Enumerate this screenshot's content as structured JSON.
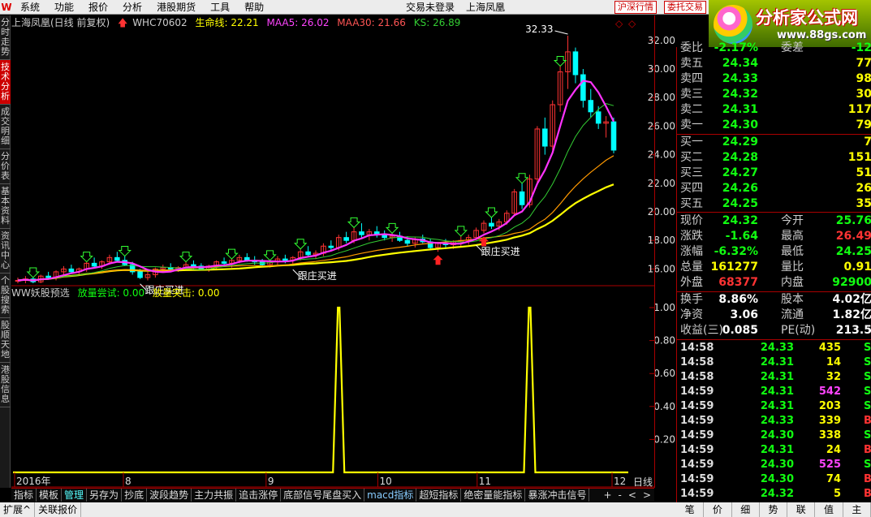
{
  "menu": {
    "logo": "W",
    "items": [
      "系统",
      "功能",
      "报价",
      "分析",
      "港股期货",
      "工具",
      "帮助"
    ],
    "login_status": "交易未登录",
    "stock_name": "上海凤凰",
    "btn_shhk": "沪深行情",
    "btn_ask": "委托交易"
  },
  "banner": {
    "title": "分析家公式网",
    "url": "www.88gs.com"
  },
  "left_tabs": [
    "分时走势",
    "技术分析",
    "成交明细",
    "分价表",
    "基本资料",
    "资讯中心",
    "个股搜索",
    "股顺天地",
    "港股信息"
  ],
  "left_tabs_active": 1,
  "chart": {
    "header": {
      "title": "上海凤凰(日线 前复权)",
      "code": "WHC70602",
      "lifeline_label": "生命线: 22.21",
      "maa5_label": "MAA5: 26.02",
      "maa30_label": "MAA30: 21.66",
      "ks_label": "KS: 26.89"
    },
    "high_label": "32.33",
    "buy_label_1": "跟庄买进",
    "buy_label_2": "跟庄买进",
    "buy_label_3": "跟庄买进",
    "price_ticks": [
      "32.00",
      "30.00",
      "28.00",
      "26.00",
      "24.00",
      "22.00",
      "20.00",
      "18.00",
      "16.00"
    ],
    "date_labels": [
      "2016年",
      "8",
      "9",
      "10",
      "11",
      "12"
    ],
    "indicator": {
      "header": "WW妖股预选",
      "label_a": "放量尝试: 0.00",
      "label_b": "放量突击: 0.00",
      "ticks": [
        "1.00",
        "0.80",
        "0.60",
        "0.40",
        "0.20"
      ]
    },
    "period": "日线"
  },
  "chart_data": {
    "type": "candlestick",
    "title": "上海凤凰(日线 前复权)",
    "ylim": [
      15.0,
      32.5
    ],
    "candles": [
      [
        15.2,
        15.4,
        15.0,
        15.2
      ],
      [
        15.2,
        15.5,
        15.0,
        15.3
      ],
      [
        15.3,
        15.4,
        15.0,
        15.1
      ],
      [
        15.1,
        15.6,
        15.0,
        15.5
      ],
      [
        15.5,
        15.8,
        15.3,
        15.4
      ],
      [
        15.4,
        15.9,
        15.2,
        15.8
      ],
      [
        15.8,
        16.2,
        15.6,
        16.0
      ],
      [
        16.0,
        16.3,
        15.7,
        15.8
      ],
      [
        15.8,
        16.1,
        15.6,
        16.0
      ],
      [
        16.0,
        16.5,
        15.8,
        16.4
      ],
      [
        16.4,
        16.8,
        16.1,
        16.2
      ],
      [
        16.2,
        16.6,
        16.0,
        16.5
      ],
      [
        16.5,
        17.0,
        16.3,
        16.8
      ],
      [
        16.8,
        17.2,
        16.5,
        16.6
      ],
      [
        16.6,
        16.9,
        16.2,
        16.3
      ],
      [
        16.3,
        16.5,
        15.6,
        15.8
      ],
      [
        15.8,
        16.0,
        15.3,
        15.4
      ],
      [
        15.4,
        15.8,
        15.2,
        15.6
      ],
      [
        15.6,
        16.1,
        15.4,
        16.0
      ],
      [
        16.0,
        16.3,
        15.8,
        16.1
      ],
      [
        16.1,
        16.4,
        15.9,
        16.0
      ],
      [
        16.0,
        16.2,
        15.8,
        16.1
      ],
      [
        16.1,
        16.5,
        15.9,
        16.3
      ],
      [
        16.3,
        16.6,
        16.0,
        16.2
      ],
      [
        16.2,
        16.4,
        15.9,
        16.0
      ],
      [
        16.0,
        16.3,
        15.8,
        16.2
      ],
      [
        16.2,
        16.6,
        16.0,
        16.5
      ],
      [
        16.5,
        16.8,
        16.2,
        16.4
      ],
      [
        16.4,
        16.7,
        16.1,
        16.6
      ],
      [
        16.6,
        17.0,
        16.4,
        16.8
      ],
      [
        16.8,
        17.1,
        16.5,
        16.6
      ],
      [
        16.6,
        16.9,
        16.3,
        16.5
      ],
      [
        16.5,
        16.7,
        16.2,
        16.3
      ],
      [
        16.3,
        16.6,
        16.1,
        16.5
      ],
      [
        16.5,
        16.9,
        16.3,
        16.7
      ],
      [
        16.7,
        17.0,
        16.4,
        16.6
      ],
      [
        16.6,
        16.9,
        16.3,
        16.8
      ],
      [
        16.8,
        17.4,
        16.6,
        17.2
      ],
      [
        17.2,
        17.6,
        16.9,
        17.0
      ],
      [
        17.0,
        17.3,
        16.7,
        17.1
      ],
      [
        17.1,
        17.8,
        16.9,
        17.6
      ],
      [
        17.6,
        18.0,
        17.3,
        17.5
      ],
      [
        17.5,
        18.4,
        17.3,
        18.2
      ],
      [
        18.2,
        18.6,
        17.8,
        18.0
      ],
      [
        18.0,
        18.9,
        17.8,
        18.6
      ],
      [
        18.6,
        19.2,
        18.2,
        18.4
      ],
      [
        18.4,
        18.8,
        18.0,
        18.6
      ],
      [
        18.6,
        19.0,
        18.2,
        18.4
      ],
      [
        18.4,
        18.7,
        18.0,
        18.2
      ],
      [
        18.2,
        18.5,
        17.9,
        18.3
      ],
      [
        18.3,
        18.6,
        17.9,
        18.0
      ],
      [
        18.0,
        18.3,
        17.6,
        17.8
      ],
      [
        17.8,
        18.2,
        17.5,
        18.1
      ],
      [
        18.1,
        18.4,
        17.8,
        17.9
      ],
      [
        17.9,
        18.1,
        17.3,
        17.5
      ],
      [
        17.5,
        17.9,
        17.2,
        17.8
      ],
      [
        17.8,
        18.1,
        17.5,
        17.7
      ],
      [
        17.7,
        18.0,
        17.4,
        17.9
      ],
      [
        17.9,
        18.3,
        17.6,
        18.0
      ],
      [
        18.0,
        18.4,
        17.7,
        18.2
      ],
      [
        18.2,
        18.9,
        18.0,
        18.7
      ],
      [
        18.7,
        19.4,
        18.5,
        19.2
      ],
      [
        19.2,
        19.6,
        18.8,
        19.0
      ],
      [
        19.0,
        19.5,
        18.7,
        19.3
      ],
      [
        19.3,
        20.1,
        19.1,
        19.9
      ],
      [
        19.9,
        21.6,
        19.7,
        21.4
      ],
      [
        21.4,
        22.0,
        20.2,
        20.5
      ],
      [
        20.5,
        22.6,
        20.3,
        22.3
      ],
      [
        22.3,
        26.0,
        22.0,
        25.8
      ],
      [
        25.8,
        26.6,
        24.0,
        24.6
      ],
      [
        24.6,
        27.8,
        24.3,
        27.5
      ],
      [
        27.5,
        30.2,
        27.0,
        29.8
      ],
      [
        29.8,
        32.33,
        28.6,
        31.2
      ],
      [
        31.2,
        31.5,
        29.0,
        29.6
      ],
      [
        29.6,
        30.0,
        27.3,
        27.8
      ],
      [
        27.8,
        28.6,
        26.6,
        27.0
      ],
      [
        27.0,
        27.4,
        25.8,
        26.2
      ],
      [
        26.2,
        26.7,
        25.2,
        26.3
      ],
      [
        26.3,
        26.6,
        24.1,
        24.32
      ]
    ],
    "signal": {
      "series": [
        {
          "name": "WW妖股预选",
          "spikes_at_index": [
            42,
            67
          ]
        }
      ],
      "ylim": [
        0,
        1.0
      ]
    }
  },
  "quote": {
    "weibi_label": "委比",
    "weibi_value": "-2.17%",
    "weicha_label": "委差",
    "weicha_value": "-12",
    "sell": [
      {
        "label": "卖五",
        "price": "24.34",
        "vol": "77"
      },
      {
        "label": "卖四",
        "price": "24.33",
        "vol": "98"
      },
      {
        "label": "卖三",
        "price": "24.32",
        "vol": "30"
      },
      {
        "label": "卖二",
        "price": "24.31",
        "vol": "117"
      },
      {
        "label": "卖一",
        "price": "24.30",
        "vol": "79"
      }
    ],
    "buy": [
      {
        "label": "买一",
        "price": "24.29",
        "vol": "7"
      },
      {
        "label": "买二",
        "price": "24.28",
        "vol": "151"
      },
      {
        "label": "买三",
        "price": "24.27",
        "vol": "51"
      },
      {
        "label": "买四",
        "price": "24.26",
        "vol": "26"
      },
      {
        "label": "买五",
        "price": "24.25",
        "vol": "35"
      }
    ],
    "stats": [
      {
        "l1": "现价",
        "v1": "24.32",
        "c1": "green",
        "l2": "今开",
        "v2": "25.76",
        "c2": "green"
      },
      {
        "l1": "涨跌",
        "v1": "-1.64",
        "c1": "green",
        "l2": "最高",
        "v2": "26.49",
        "c2": "red"
      },
      {
        "l1": "涨幅",
        "v1": "-6.32%",
        "c1": "green",
        "l2": "最低",
        "v2": "24.25",
        "c2": "green"
      },
      {
        "l1": "总量",
        "v1": "161277",
        "c1": "yellow",
        "l2": "量比",
        "v2": "0.91",
        "c2": "yellow"
      },
      {
        "l1": "外盘",
        "v1": "68377",
        "c1": "red",
        "l2": "内盘",
        "v2": "92900",
        "c2": "green"
      }
    ],
    "stats2": [
      {
        "l1": "换手",
        "v1": "8.86%",
        "c1": "white",
        "l2": "股本",
        "v2": "4.02亿",
        "c2": "white"
      },
      {
        "l1": "净资",
        "v1": "3.06",
        "c1": "white",
        "l2": "流通",
        "v2": "1.82亿",
        "c2": "white"
      },
      {
        "l1": "收益(三)",
        "v1": "0.085",
        "c1": "white",
        "l2": "PE(动)",
        "v2": "213.5",
        "c2": "white"
      }
    ],
    "ticks": [
      {
        "time": "14:58",
        "price": "24.33",
        "vol": "435",
        "dir": "S",
        "vc": "yellow"
      },
      {
        "time": "14:58",
        "price": "24.31",
        "vol": "14",
        "dir": "S",
        "vc": "yellow"
      },
      {
        "time": "14:58",
        "price": "24.31",
        "vol": "32",
        "dir": "S",
        "vc": "yellow"
      },
      {
        "time": "14:59",
        "price": "24.31",
        "vol": "542",
        "dir": "S",
        "vc": "magenta"
      },
      {
        "time": "14:59",
        "price": "24.31",
        "vol": "203",
        "dir": "S",
        "vc": "yellow"
      },
      {
        "time": "14:59",
        "price": "24.33",
        "vol": "339",
        "dir": "B",
        "vc": "yellow"
      },
      {
        "time": "14:59",
        "price": "24.30",
        "vol": "338",
        "dir": "S",
        "vc": "yellow"
      },
      {
        "time": "14:59",
        "price": "24.31",
        "vol": "24",
        "dir": "B",
        "vc": "yellow"
      },
      {
        "time": "14:59",
        "price": "24.30",
        "vol": "525",
        "dir": "S",
        "vc": "magenta"
      },
      {
        "time": "14:59",
        "price": "24.30",
        "vol": "74",
        "dir": "B",
        "vc": "yellow"
      },
      {
        "time": "14:59",
        "price": "24.32",
        "vol": "5",
        "dir": "B",
        "vc": "yellow"
      }
    ],
    "bottom_tabs": [
      "笔",
      "价",
      "细",
      "势",
      "联",
      "值",
      "主"
    ]
  },
  "tabbar": {
    "items": [
      "指标",
      "模板",
      "管理",
      "另存为",
      "抄底",
      "波段趋势",
      "主力共振",
      "追击涨停",
      "底部信号尾盘买入",
      "macd指标",
      "超短指标",
      "绝密量能指标",
      "暴涨冲击信号"
    ],
    "active": 2,
    "controls": [
      "+",
      "-",
      "<",
      ">"
    ]
  },
  "statusbar": {
    "items": [
      "扩展^",
      "关联报价"
    ]
  },
  "colors": {
    "up": "#ff3333",
    "down": "#00ffff",
    "maa5": "#ff33ff",
    "maa30": "#ffff00",
    "lifeline": "#ffffff",
    "ks": "#33cc33",
    "signal": "#ffff00",
    "axis": "#aa0000"
  }
}
